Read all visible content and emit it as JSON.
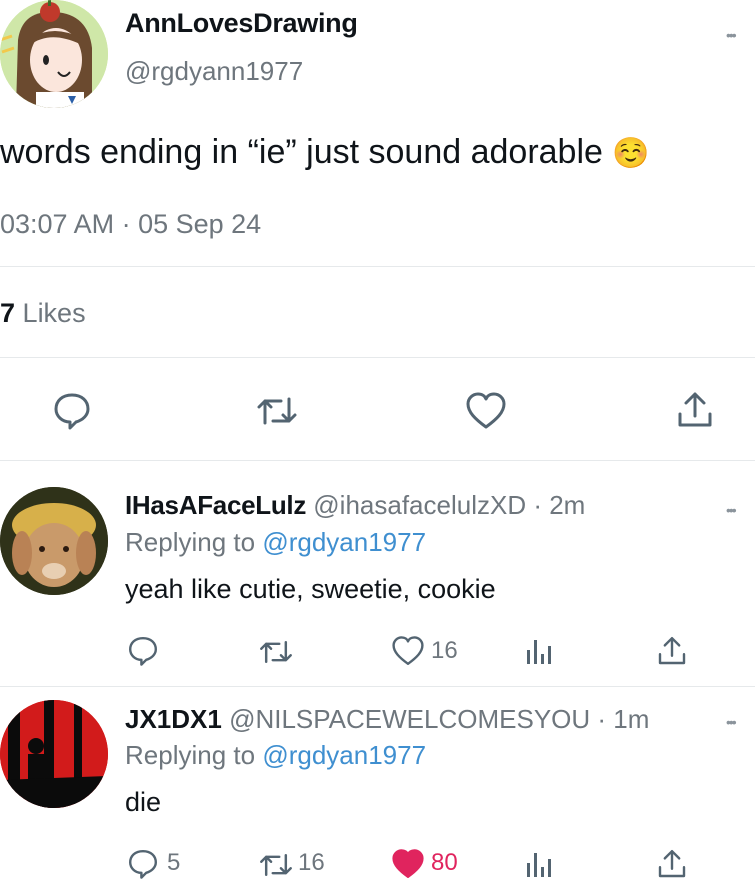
{
  "tweet": {
    "author_name": "AnnLovesDrawing",
    "author_handle": "@rgdyann1977",
    "text": "words ending in “ie” just sound adorable",
    "emoji": "☺️",
    "timestamp": "03:07 AM · 05 Sep 24",
    "likes_count": "7",
    "likes_label": "Likes",
    "avatar_icon": "cartoon-girl-avatar",
    "more_label": "•••"
  },
  "actions": {
    "reply_icon": "comment-icon",
    "retweet_icon": "retweet-icon",
    "like_icon": "heart-icon",
    "share_icon": "share-icon"
  },
  "replies": [
    {
      "name": "IHasAFaceLulz",
      "handle": "@ihasafacelulzXD",
      "time": "· 2m",
      "replying_prefix": "Replying to",
      "replying_to": "@rgdyan1977",
      "text": "yeah like cutie, sweetie, cookie",
      "reply_count": "",
      "retweet_count": "",
      "like_count": "16",
      "liked": false,
      "avatar_icon": "rabbit-avatar",
      "more_label": "•••"
    },
    {
      "name": "JX1DX1",
      "handle": "@NILSPACEWELCOMESYOU",
      "time": "· 1m",
      "replying_prefix": "Replying to",
      "replying_to": "@rgdyan1977",
      "text": "die",
      "reply_count": "5",
      "retweet_count": "16",
      "like_count": "80",
      "liked": true,
      "avatar_icon": "red-silhouette-avatar",
      "more_label": "•••"
    }
  ],
  "colors": {
    "like_active": "#e0245e",
    "link_blue": "#3f8fd0",
    "grey_text": "#6e767d"
  }
}
